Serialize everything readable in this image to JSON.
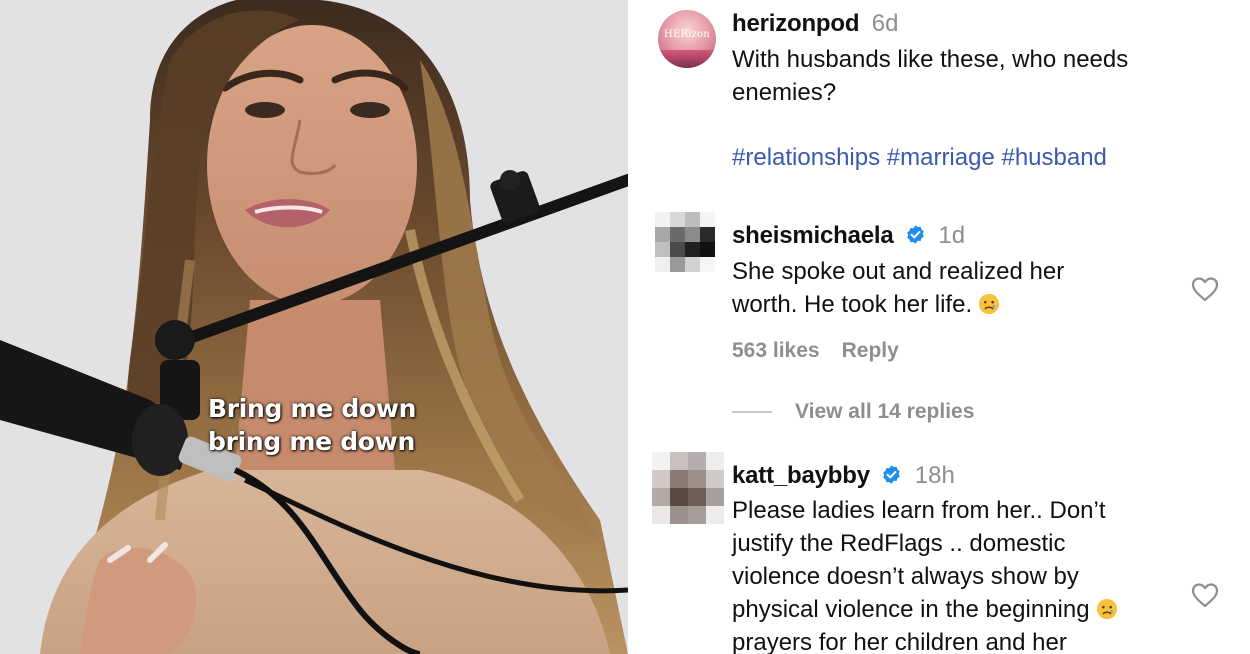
{
  "video": {
    "caption_lines": [
      "Bring me down",
      "bring me down"
    ]
  },
  "post": {
    "owner": {
      "username": "herizonpod",
      "time": "6d",
      "avatar_logo": "HERizon"
    },
    "caption_lines": [
      "With husbands like these, who needs",
      "enemies?"
    ],
    "hashtags": "#relationships #marriage #husband"
  },
  "comments": [
    {
      "username": "sheismichaela",
      "verified": true,
      "time": "1d",
      "lines": [
        "She spoke out and realized her",
        "worth. He took her life."
      ],
      "emoji": "crying-face-icon",
      "likes": "563 likes",
      "reply_label": "Reply",
      "view_replies": "View all 14 replies"
    },
    {
      "username": "katt_baybby",
      "verified": true,
      "time": "18h",
      "lines": [
        "Please ladies learn from her.. Don’t",
        "justify the RedFlags .. domestic",
        "violence doesn’t always show by",
        "physical violence in the beginning",
        "prayers for her children and her"
      ],
      "emoji": "crying-face-icon"
    }
  ],
  "colors": {
    "hashtag": "#3a5ab0",
    "muted": "#8e8e8e",
    "verified": "#1d8ff2",
    "text": "#111111"
  }
}
